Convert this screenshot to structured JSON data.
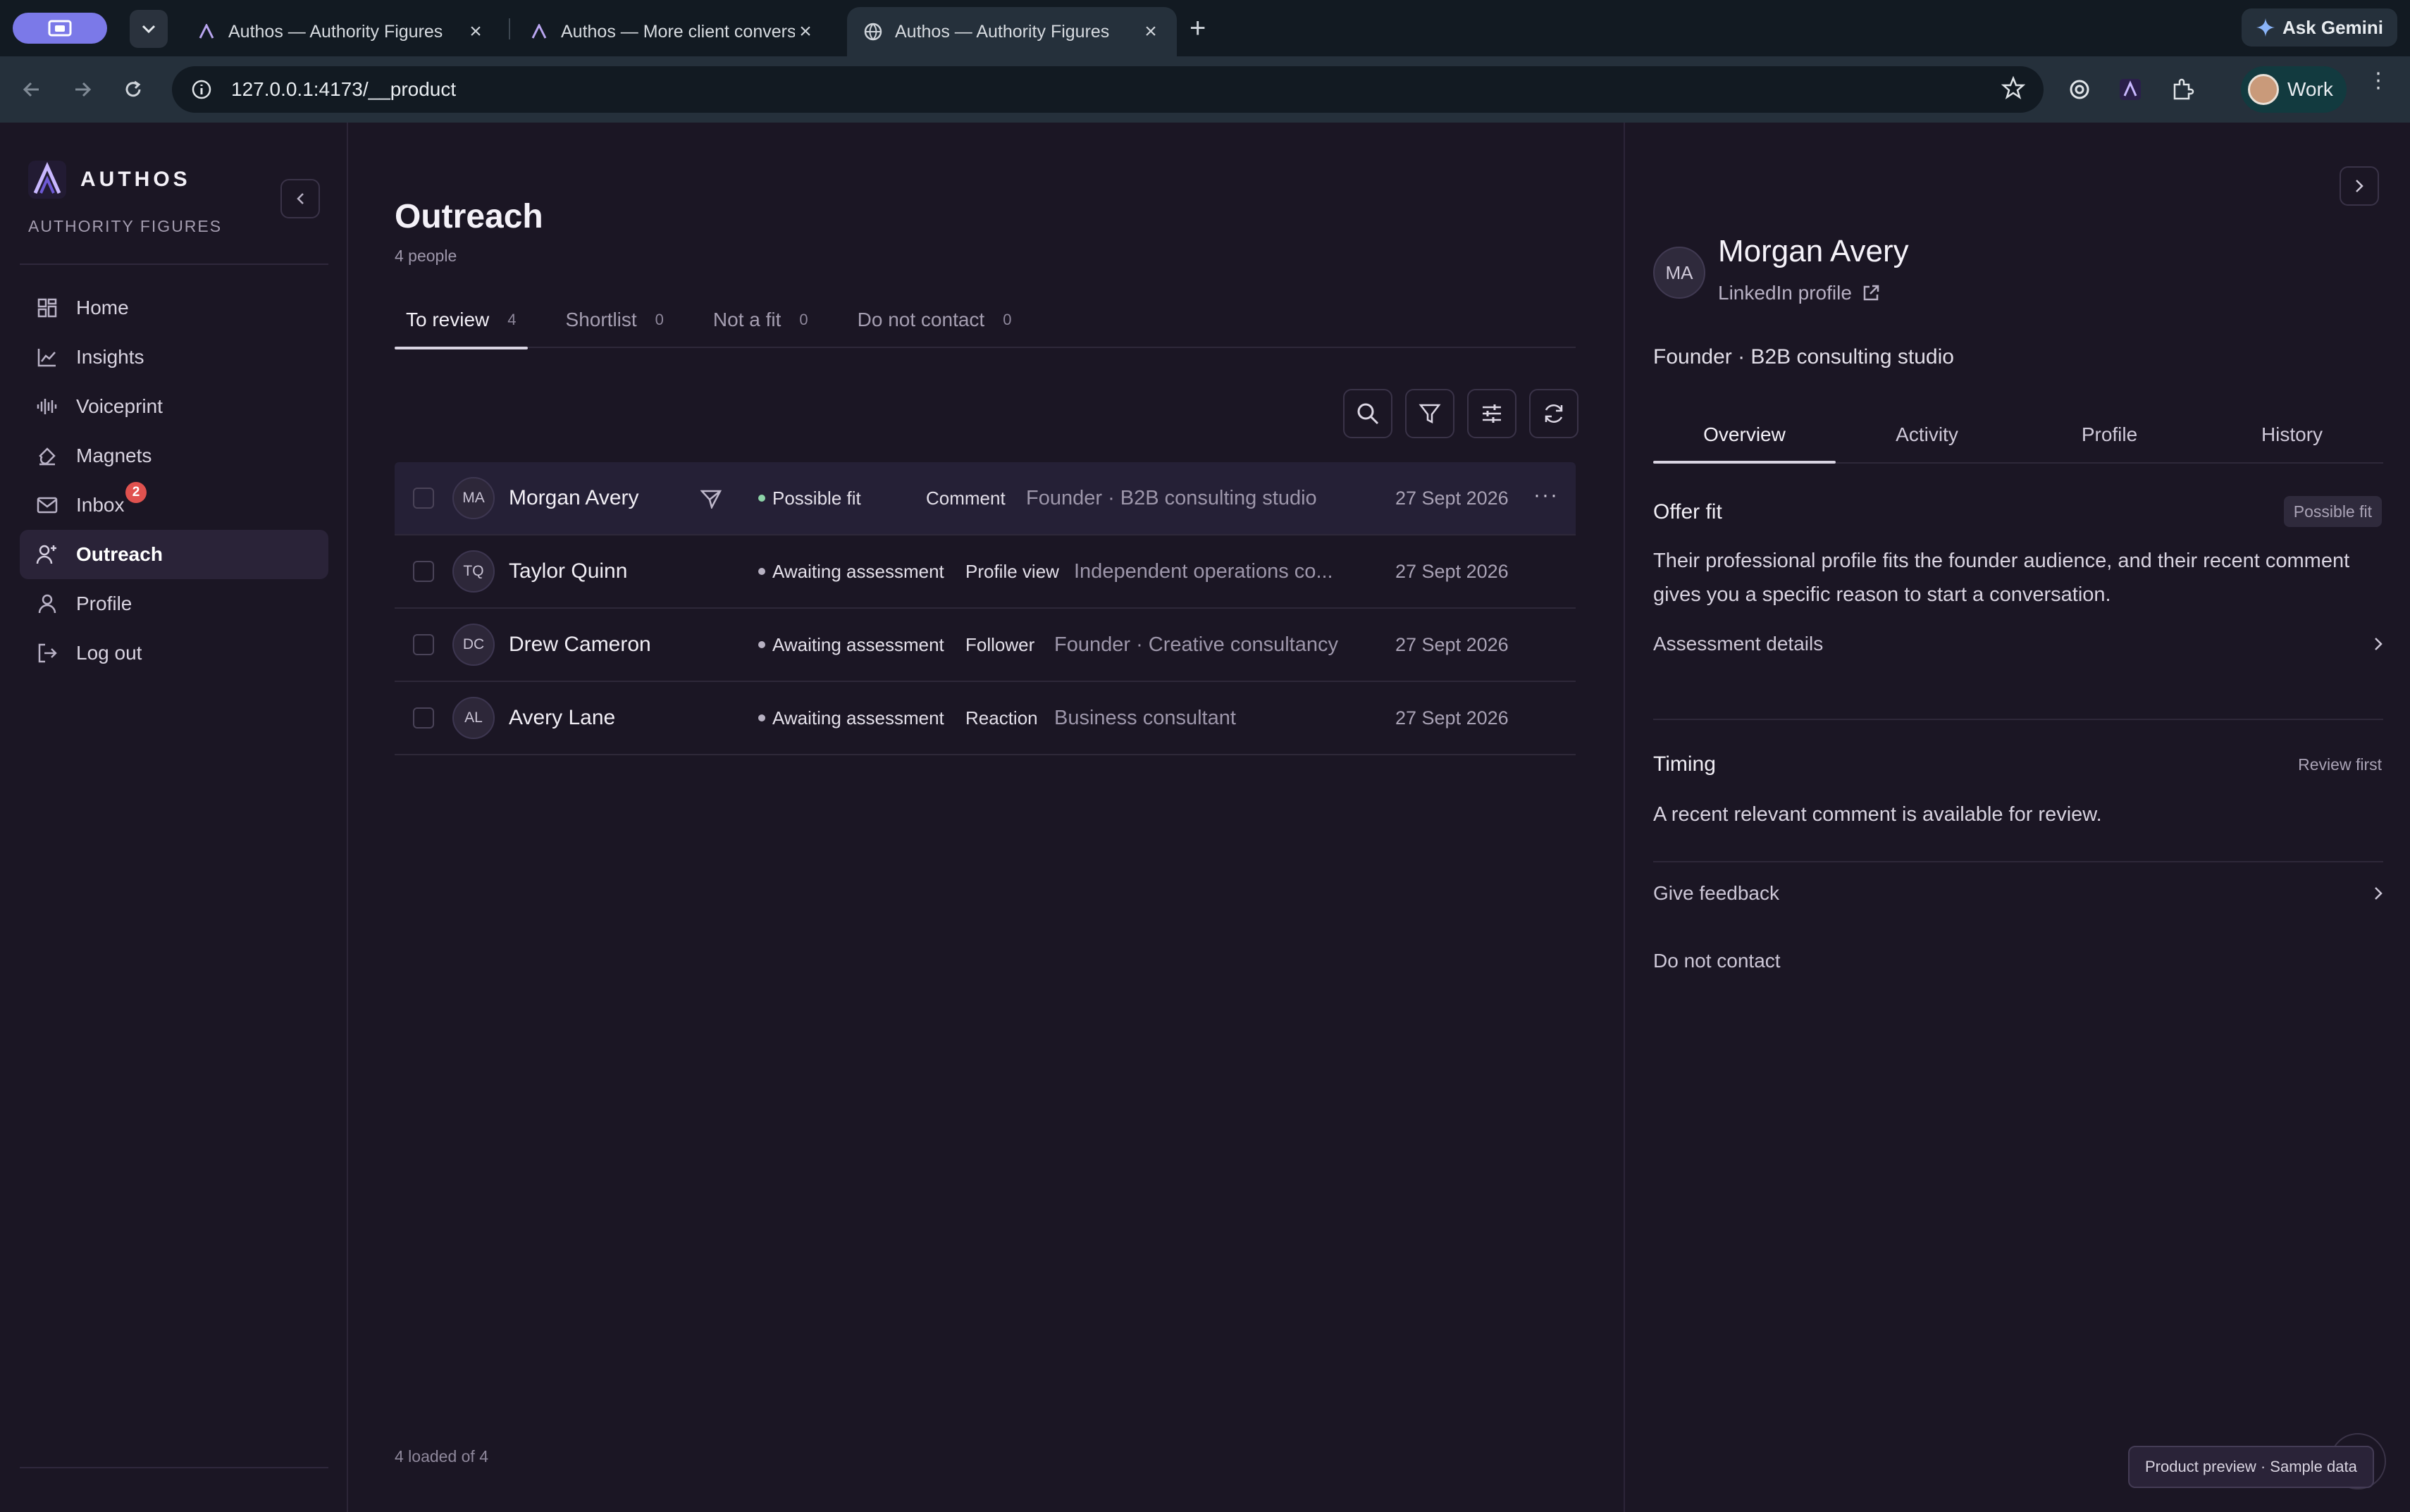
{
  "browser": {
    "tabs": [
      {
        "title": "Authos — Authority Figures",
        "active": false
      },
      {
        "title": "Authos — More client convers",
        "active": false
      },
      {
        "title": "Authos — Authority Figures",
        "active": true
      }
    ],
    "url": "127.0.0.1:4173/__product",
    "ask_gemini": "Ask Gemini",
    "profile_label": "Work"
  },
  "sidebar": {
    "brand": "AUTHOS",
    "subtitle": "AUTHORITY FIGURES",
    "items": [
      {
        "label": "Home",
        "icon": "grid-icon"
      },
      {
        "label": "Insights",
        "icon": "chart-icon"
      },
      {
        "label": "Voiceprint",
        "icon": "waveform-icon"
      },
      {
        "label": "Magnets",
        "icon": "magnet-icon"
      },
      {
        "label": "Inbox",
        "icon": "mail-icon",
        "badge": "2"
      },
      {
        "label": "Outreach",
        "icon": "user-plus-icon",
        "active": true
      },
      {
        "label": "Profile",
        "icon": "user-icon"
      },
      {
        "label": "Log out",
        "icon": "logout-icon"
      }
    ]
  },
  "main": {
    "title": "Outreach",
    "subtitle": "4 people",
    "tabs": [
      {
        "label": "To review",
        "count": "4"
      },
      {
        "label": "Shortlist",
        "count": "0"
      },
      {
        "label": "Not a fit",
        "count": "0"
      },
      {
        "label": "Do not contact",
        "count": "0"
      }
    ],
    "rows": [
      {
        "initials": "MA",
        "name": "Morgan Avery",
        "status": "Possible fit",
        "signal": "Comment",
        "desc": "Founder · B2B consulting studio",
        "date": "27 Sept 2026"
      },
      {
        "initials": "TQ",
        "name": "Taylor Quinn",
        "status": "Awaiting assessment",
        "signal": "Profile view",
        "desc": "Independent operations co...",
        "date": "27 Sept 2026"
      },
      {
        "initials": "DC",
        "name": "Drew Cameron",
        "status": "Awaiting assessment",
        "signal": "Follower",
        "desc": "Founder · Creative consultancy",
        "date": "27 Sept 2026"
      },
      {
        "initials": "AL",
        "name": "Avery Lane",
        "status": "Awaiting assessment",
        "signal": "Reaction",
        "desc": "Business consultant",
        "date": "27 Sept 2026"
      }
    ],
    "loaded": "4 loaded of 4"
  },
  "panel": {
    "initials": "MA",
    "name": "Morgan Avery",
    "link": "LinkedIn profile",
    "role": "Founder · B2B consulting studio",
    "tabs": [
      "Overview",
      "Activity",
      "Profile",
      "History"
    ],
    "offer_fit": {
      "title": "Offer fit",
      "chip": "Possible fit",
      "text": "Their professional profile fits the founder audience, and their recent comment gives you a specific reason to start a conversation.",
      "details": "Assessment details"
    },
    "timing": {
      "title": "Timing",
      "meta": "Review first",
      "text": "A recent relevant comment is available for review."
    },
    "feedback": "Give feedback",
    "do_not_contact": "Do not contact"
  },
  "footer_chip": "Product preview · Sample data",
  "colors": {
    "accent": "#7b79e8",
    "badge": "#e0524f",
    "positive": "#8dd3a8"
  }
}
